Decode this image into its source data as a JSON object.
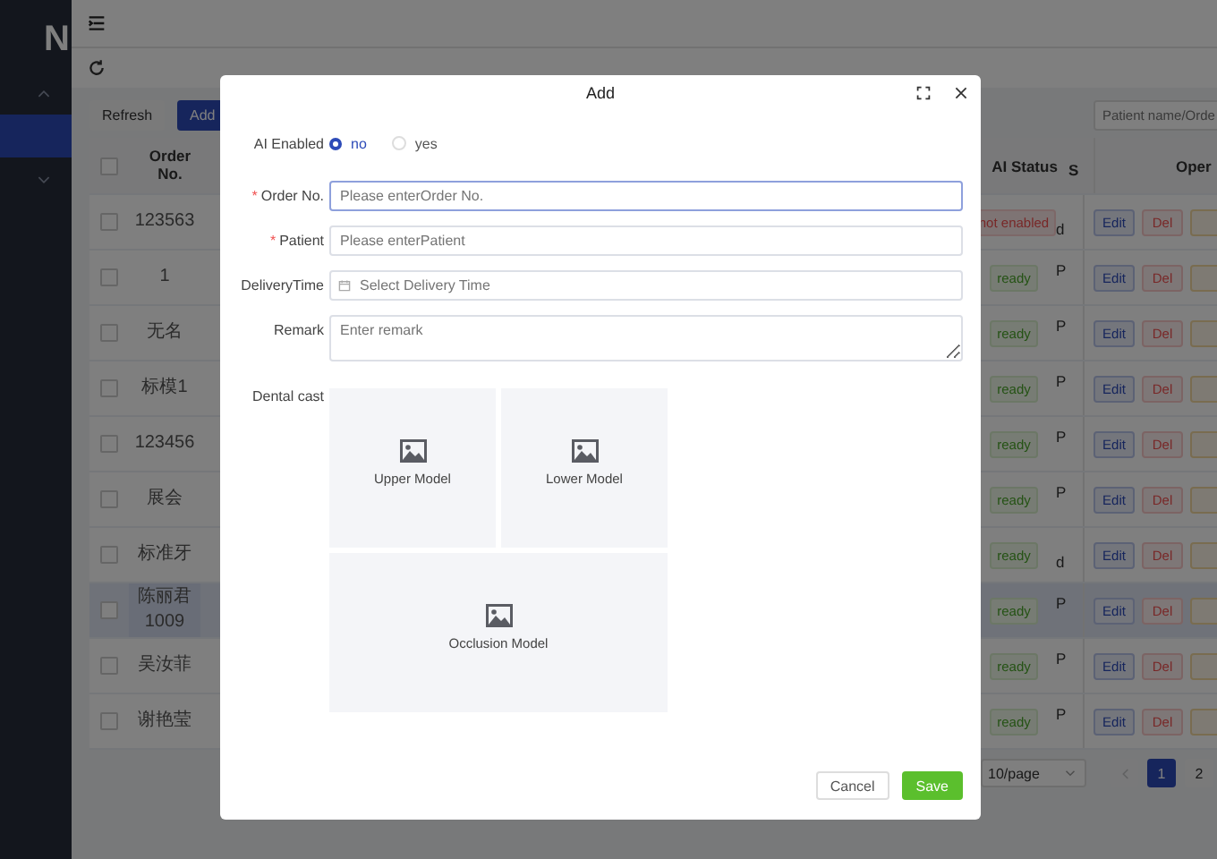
{
  "sidebar": {
    "logo": "N",
    "menu": [
      {
        "kind": "group",
        "expanded": true,
        "selected": false
      },
      {
        "kind": "item",
        "selected": true
      },
      {
        "kind": "group",
        "expanded": false,
        "selected": false
      }
    ]
  },
  "toolbar": {
    "buttons": [
      {
        "label": "Refresh",
        "kind": "plain"
      },
      {
        "label": "Add",
        "kind": "primary"
      }
    ],
    "search": {
      "placeholder": "Patient name/Orde"
    }
  },
  "table": {
    "columns": [
      "Order No.",
      "AI Status",
      "S",
      "Oper"
    ],
    "header_checked": false,
    "rows": [
      {
        "order_no": "123563",
        "ai_status": "not enabled",
        "enabled": false,
        "column_s": "d",
        "checked": false,
        "selected": false,
        "actions": [
          {
            "label": "Edit",
            "kind": "primary"
          },
          {
            "label": "Del",
            "kind": "danger"
          },
          {
            "kind": "warning"
          }
        ]
      },
      {
        "order_no": "1",
        "ai_status": "ready",
        "enabled": true,
        "column_s": "P",
        "checked": false,
        "selected": false,
        "actions": [
          {
            "label": "Edit",
            "kind": "primary"
          },
          {
            "label": "Del",
            "kind": "danger"
          },
          {
            "kind": "warning"
          }
        ]
      },
      {
        "order_no": "无名",
        "ai_status": "ready",
        "enabled": true,
        "column_s": "P",
        "checked": false,
        "selected": false,
        "actions": [
          {
            "label": "Edit",
            "kind": "primary"
          },
          {
            "label": "Del",
            "kind": "danger"
          },
          {
            "kind": "warning"
          }
        ]
      },
      {
        "order_no": "标模1",
        "ai_status": "ready",
        "enabled": true,
        "column_s": "P",
        "checked": false,
        "selected": false,
        "actions": [
          {
            "label": "Edit",
            "kind": "primary"
          },
          {
            "label": "Del",
            "kind": "danger"
          },
          {
            "kind": "warning"
          }
        ]
      },
      {
        "order_no": "123456",
        "ai_status": "ready",
        "enabled": true,
        "column_s": "P",
        "checked": false,
        "selected": false,
        "actions": [
          {
            "label": "Edit",
            "kind": "primary"
          },
          {
            "label": "Del",
            "kind": "danger"
          },
          {
            "kind": "warning"
          }
        ]
      },
      {
        "order_no": "展会",
        "ai_status": "ready",
        "enabled": true,
        "column_s": "P",
        "checked": false,
        "selected": false,
        "actions": [
          {
            "label": "Edit",
            "kind": "primary"
          },
          {
            "label": "Del",
            "kind": "danger"
          },
          {
            "kind": "warning"
          }
        ]
      },
      {
        "order_no": "标准牙",
        "ai_status": "ready",
        "enabled": true,
        "column_s": "d",
        "checked": false,
        "selected": false,
        "actions": [
          {
            "label": "Edit",
            "kind": "primary"
          },
          {
            "label": "Del",
            "kind": "danger"
          },
          {
            "kind": "warning"
          }
        ]
      },
      {
        "order_no": "陈丽君 1009",
        "ai_status": "ready",
        "enabled": true,
        "column_s": "P",
        "checked": false,
        "selected": true,
        "actions": [
          {
            "label": "Edit",
            "kind": "primary"
          },
          {
            "label": "Del",
            "kind": "danger"
          },
          {
            "kind": "warning"
          }
        ]
      },
      {
        "order_no": "吴汝菲",
        "ai_status": "ready",
        "enabled": true,
        "column_s": "P",
        "checked": false,
        "selected": false,
        "actions": [
          {
            "label": "Edit",
            "kind": "primary"
          },
          {
            "label": "Del",
            "kind": "danger"
          },
          {
            "kind": "warning"
          }
        ]
      },
      {
        "order_no": "谢艳莹",
        "ai_status": "ready",
        "enabled": true,
        "column_s": "P",
        "checked": false,
        "selected": false,
        "actions": [
          {
            "label": "Edit",
            "kind": "primary"
          },
          {
            "label": "Del",
            "kind": "danger"
          },
          {
            "kind": "warning"
          }
        ]
      }
    ]
  },
  "pagination": {
    "page_size": "10/page",
    "prev_disabled": true,
    "pages": [
      {
        "label": "1",
        "selected": true
      },
      {
        "label": "2",
        "selected": false
      }
    ]
  },
  "dialog": {
    "title": "Add",
    "fields": [
      {
        "kind": "radio",
        "label": "AI Enabled",
        "options": [
          {
            "label": "no",
            "selected": true
          },
          {
            "label": "yes",
            "selected": false
          }
        ]
      },
      {
        "kind": "input",
        "label": "Order No.",
        "required_mark": "*",
        "placeholder": "Please enterOrder No.",
        "focused": true
      },
      {
        "kind": "input",
        "label": "Patient",
        "required_mark": "*",
        "placeholder": "Please enterPatient",
        "focused": false
      },
      {
        "kind": "date",
        "label": "DeliveryTime",
        "placeholder": "Select Delivery Time",
        "focused": false
      },
      {
        "kind": "textarea",
        "label": "Remark",
        "placeholder": "Enter remark",
        "focused": false
      }
    ],
    "upload": {
      "label": "Dental cast",
      "slots": [
        {
          "label": "Upper Model",
          "wide": false
        },
        {
          "label": "Lower Model",
          "wide": false
        },
        {
          "label": "Occlusion Model",
          "wide": true
        }
      ]
    },
    "buttons": [
      {
        "label": "Cancel",
        "kind": "plain"
      },
      {
        "label": "Save",
        "kind": "success"
      }
    ]
  }
}
